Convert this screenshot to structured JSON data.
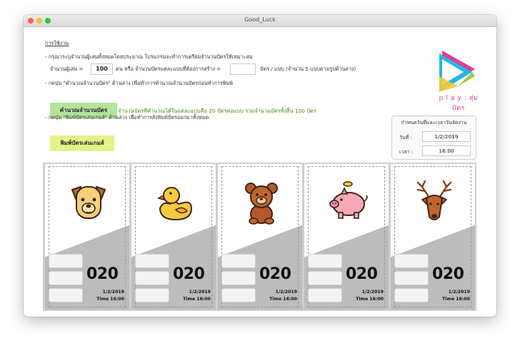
{
  "window": {
    "title": "Good_Luck"
  },
  "instructions": {
    "heading": "การใช้งาน",
    "line1": "- กรุณาระบุจำนวนผู้เล่นทั้งหมดโดยประมาณ โปรแกรมจะทำการเตรียมจำนวนบัตรให้เหมาะสม",
    "players_label": "จำนวนผู้เล่น =",
    "players_value": "100",
    "players_unit": "คน หรือ จำนวนบัตรแต่ละแบบที่ต้องการสร้าง =",
    "cards_value": "",
    "cards_unit": "บัตร / แบบ (จำนวน 5 แบบตามรูปด้านล่าง)",
    "line2": "- กดปุ่ม \"คำนวณจำนวนบัตร\" ด้านล่าง เพื่อทำการคำนวณจำนวนบัตรก่อนทำการพิมพ์",
    "calc_button": "คำนวณจำนวนบัตร",
    "calc_result": "จำนวนบัตรที่คำนวณได้ในแต่ละแบบคือ 20 บัตรต่อแบบ รวมจำนวนบัตรทั้งสิ้น 100 บัตร",
    "line3": "- กดปุ่ม \"พิมพ์บัตรเล่นเกมส์\" ด้านล่าง เพื่อทำการสั่งพิมพ์บัตรออกมาทั้งหมด",
    "print_button": "พิมพ์บัตรเล่นเกมส์"
  },
  "logo": {
    "text": "p l a y : สุ่มบัตร",
    "colors": [
      "#e63a8f",
      "#20b7e6",
      "#f6c83a",
      "#8dc63f"
    ]
  },
  "schedule": {
    "heading": "กำหนดวันที่และเวลาวันจัดงาน",
    "date_label": "วันที่ :",
    "date_value": "1/2/2019",
    "time_label": "เวลา :",
    "time_value": "16:00"
  },
  "cards": [
    {
      "animal": "dog-icon",
      "number": "020",
      "date": "1/2/2019",
      "time": "Time 16:00"
    },
    {
      "animal": "duck-icon",
      "number": "020",
      "date": "1/2/2019",
      "time": "Time 16:00"
    },
    {
      "animal": "bear-icon",
      "number": "020",
      "date": "1/2/2019",
      "time": "Time 16:00"
    },
    {
      "animal": "pig-icon",
      "number": "020",
      "date": "1/2/2019",
      "time": "Time 16:00"
    },
    {
      "animal": "deer-icon",
      "number": "020",
      "date": "1/2/2019",
      "time": "Time 16:00"
    }
  ]
}
